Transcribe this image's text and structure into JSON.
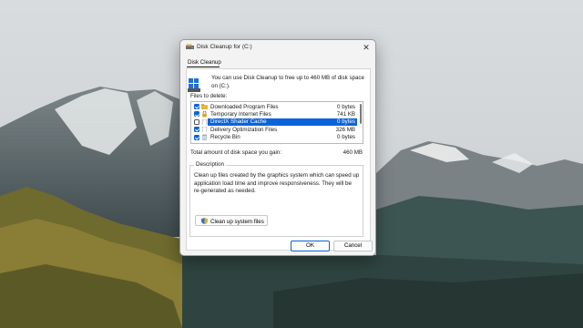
{
  "window": {
    "title": "Disk Cleanup for  (C:)",
    "close_glyph": "✕"
  },
  "tab": {
    "label": "Disk Cleanup"
  },
  "intro": {
    "text": "You can use Disk Cleanup to free up to 460 MB of disk space on  (C:).",
    "icon": "drive-icon"
  },
  "files_label": "Files to delete:",
  "files": [
    {
      "name": "Downloaded Program Files",
      "size": "0 bytes",
      "checked": true,
      "selected": false
    },
    {
      "name": "Temporary Internet Files",
      "size": "741 KB",
      "checked": true,
      "selected": false
    },
    {
      "name": "DirectX Shader Cache",
      "size": "0 bytes",
      "checked": false,
      "selected": true
    },
    {
      "name": "Delivery Optimization Files",
      "size": "326 MB",
      "checked": true,
      "selected": false
    },
    {
      "name": "Recycle Bin",
      "size": "0 bytes",
      "checked": true,
      "selected": false
    }
  ],
  "total": {
    "label": "Total amount of disk space you gain:",
    "value": "460 MB"
  },
  "description": {
    "title": "Description",
    "text": "Clean up files created by the graphics system which can speed up application load time and improve responsiveness. They will be re-generated as needed."
  },
  "cleanup_button": {
    "label": "Clean up system files"
  },
  "buttons": {
    "ok": "OK",
    "cancel": "Cancel"
  },
  "colors": {
    "accent": "#0a64d8",
    "dialog_bg": "#f3f3f3"
  }
}
